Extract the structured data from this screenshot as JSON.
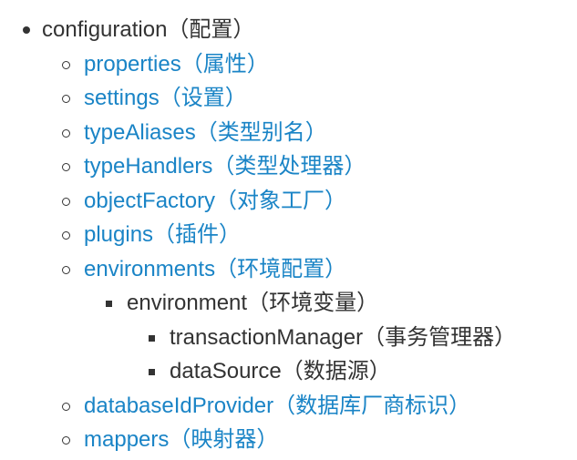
{
  "colors": {
    "text": "#333333",
    "link": "#1a84c6",
    "background": "#ffffff"
  },
  "tree": {
    "root": {
      "label": "configuration（配置）"
    },
    "properties": {
      "label": "properties（属性）"
    },
    "settings": {
      "label": "settings（设置）"
    },
    "typeAliases": {
      "label": "typeAliases（类型别名）"
    },
    "typeHandlers": {
      "label": "typeHandlers（类型处理器）"
    },
    "objectFactory": {
      "label": "objectFactory（对象工厂）"
    },
    "plugins": {
      "label": "plugins（插件）"
    },
    "environments": {
      "label": "environments（环境配置）"
    },
    "environment": {
      "label": "environment（环境变量）"
    },
    "transactionManager": {
      "label": "transactionManager（事务管理器）"
    },
    "dataSource": {
      "label": "dataSource（数据源）"
    },
    "databaseIdProvider": {
      "label": "databaseIdProvider（数据库厂商标识）"
    },
    "mappers": {
      "label": "mappers（映射器）"
    }
  }
}
